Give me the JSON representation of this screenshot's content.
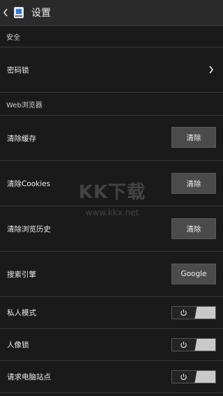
{
  "header": {
    "back_icon": "chevron-left-icon",
    "app_icon": "app-logo-icon",
    "title": "设置"
  },
  "sections": {
    "security": "安全",
    "web_browser": "Web浏览器"
  },
  "rows": {
    "password_lock": {
      "label": "密码锁",
      "icon": "chevron-right-icon"
    },
    "clear_cache": {
      "label": "清除缓存",
      "button": "清除"
    },
    "clear_cookies": {
      "label": "清除Cookies",
      "button": "清除"
    },
    "clear_history": {
      "label": "清除浏览历史",
      "button": "清除"
    },
    "search_engine": {
      "label": "搜索引擎",
      "button": "Google"
    },
    "private_mode": {
      "label": "私人模式",
      "state": "off"
    },
    "portrait_lock": {
      "label": "人像锁",
      "state": "off"
    },
    "desktop_site": {
      "label": "请求电脑站点",
      "state": "off"
    }
  },
  "watermark": {
    "main": "KK下载",
    "sub": "www.kkx.net"
  },
  "colors": {
    "background": "#1a1a1a",
    "button": "#4b4b4b",
    "toggle_fill": "#c9c9c9"
  }
}
